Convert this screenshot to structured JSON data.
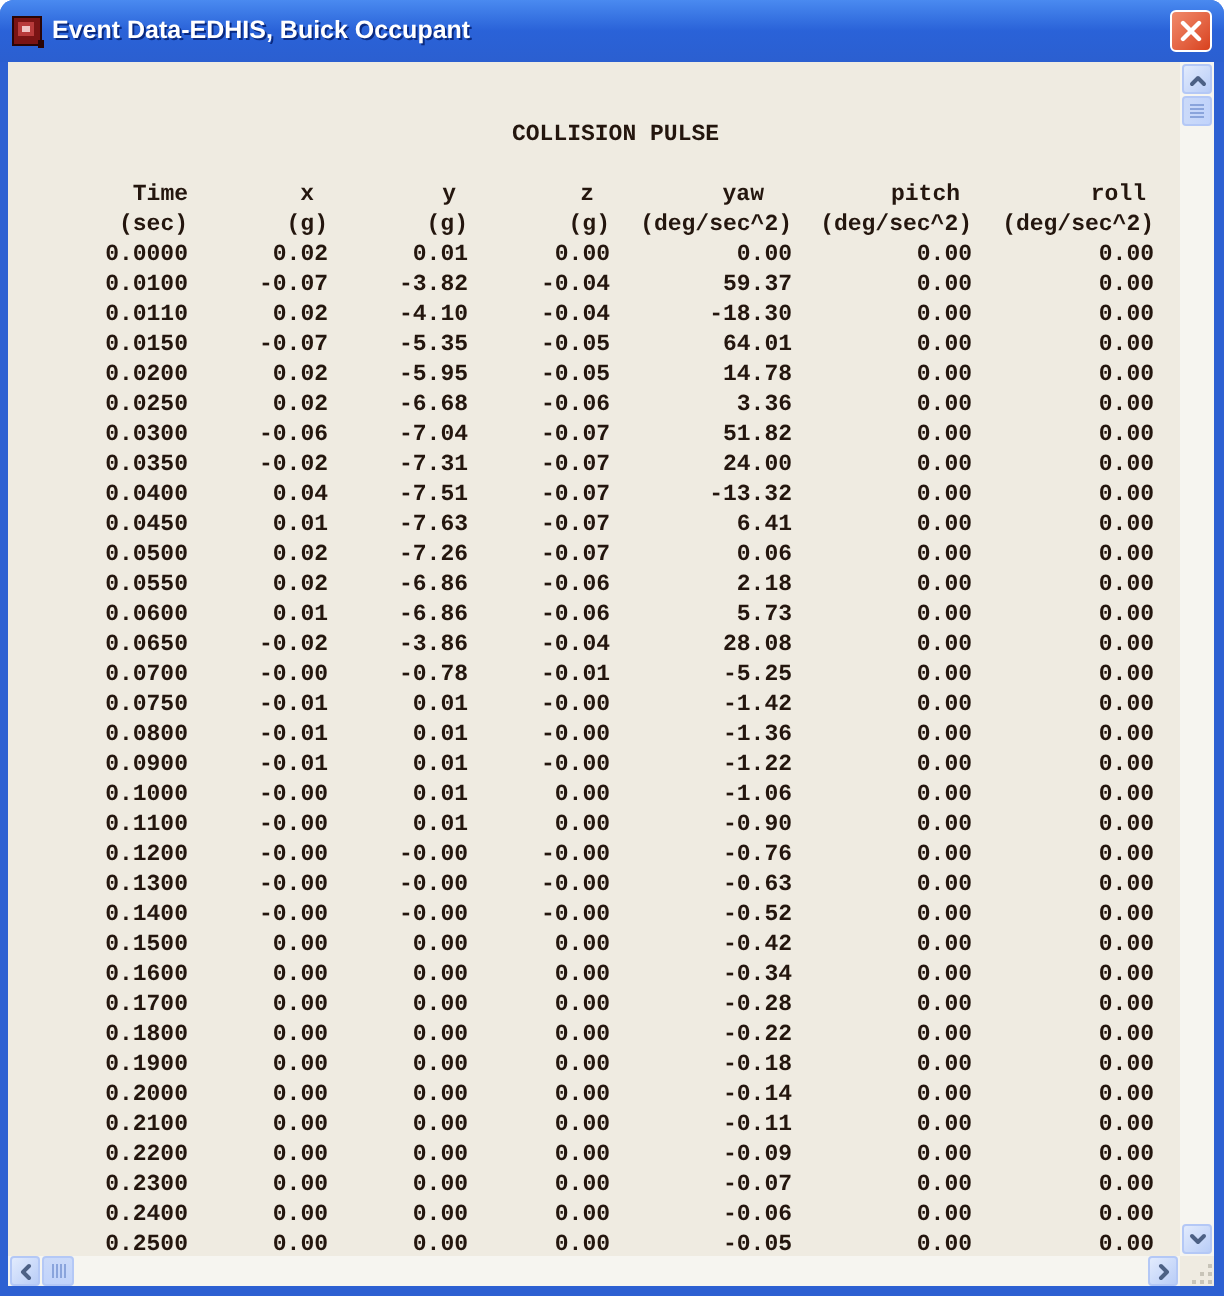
{
  "window": {
    "title": "Event Data-EDHIS, Buick Occupant"
  },
  "report": {
    "title": "COLLISION PULSE",
    "columns": [
      {
        "name": "Time",
        "unit": "(sec)"
      },
      {
        "name": "x",
        "unit": "(g)"
      },
      {
        "name": "y",
        "unit": "(g)"
      },
      {
        "name": "z",
        "unit": "(g)"
      },
      {
        "name": "yaw",
        "unit": "(deg/sec^2)"
      },
      {
        "name": "pitch",
        "unit": "(deg/sec^2)"
      },
      {
        "name": "roll",
        "unit": "(deg/sec^2)"
      }
    ],
    "rows": [
      [
        "0.0000",
        "0.02",
        "0.01",
        "0.00",
        "0.00",
        "0.00",
        "0.00"
      ],
      [
        "0.0100",
        "-0.07",
        "-3.82",
        "-0.04",
        "59.37",
        "0.00",
        "0.00"
      ],
      [
        "0.0110",
        "0.02",
        "-4.10",
        "-0.04",
        "-18.30",
        "0.00",
        "0.00"
      ],
      [
        "0.0150",
        "-0.07",
        "-5.35",
        "-0.05",
        "64.01",
        "0.00",
        "0.00"
      ],
      [
        "0.0200",
        "0.02",
        "-5.95",
        "-0.05",
        "14.78",
        "0.00",
        "0.00"
      ],
      [
        "0.0250",
        "0.02",
        "-6.68",
        "-0.06",
        "3.36",
        "0.00",
        "0.00"
      ],
      [
        "0.0300",
        "-0.06",
        "-7.04",
        "-0.07",
        "51.82",
        "0.00",
        "0.00"
      ],
      [
        "0.0350",
        "-0.02",
        "-7.31",
        "-0.07",
        "24.00",
        "0.00",
        "0.00"
      ],
      [
        "0.0400",
        "0.04",
        "-7.51",
        "-0.07",
        "-13.32",
        "0.00",
        "0.00"
      ],
      [
        "0.0450",
        "0.01",
        "-7.63",
        "-0.07",
        "6.41",
        "0.00",
        "0.00"
      ],
      [
        "0.0500",
        "0.02",
        "-7.26",
        "-0.07",
        "0.06",
        "0.00",
        "0.00"
      ],
      [
        "0.0550",
        "0.02",
        "-6.86",
        "-0.06",
        "2.18",
        "0.00",
        "0.00"
      ],
      [
        "0.0600",
        "0.01",
        "-6.86",
        "-0.06",
        "5.73",
        "0.00",
        "0.00"
      ],
      [
        "0.0650",
        "-0.02",
        "-3.86",
        "-0.04",
        "28.08",
        "0.00",
        "0.00"
      ],
      [
        "0.0700",
        "-0.00",
        "-0.78",
        "-0.01",
        "-5.25",
        "0.00",
        "0.00"
      ],
      [
        "0.0750",
        "-0.01",
        "0.01",
        "-0.00",
        "-1.42",
        "0.00",
        "0.00"
      ],
      [
        "0.0800",
        "-0.01",
        "0.01",
        "-0.00",
        "-1.36",
        "0.00",
        "0.00"
      ],
      [
        "0.0900",
        "-0.01",
        "0.01",
        "-0.00",
        "-1.22",
        "0.00",
        "0.00"
      ],
      [
        "0.1000",
        "-0.00",
        "0.01",
        "0.00",
        "-1.06",
        "0.00",
        "0.00"
      ],
      [
        "0.1100",
        "-0.00",
        "0.01",
        "0.00",
        "-0.90",
        "0.00",
        "0.00"
      ],
      [
        "0.1200",
        "-0.00",
        "-0.00",
        "-0.00",
        "-0.76",
        "0.00",
        "0.00"
      ],
      [
        "0.1300",
        "-0.00",
        "-0.00",
        "-0.00",
        "-0.63",
        "0.00",
        "0.00"
      ],
      [
        "0.1400",
        "-0.00",
        "-0.00",
        "-0.00",
        "-0.52",
        "0.00",
        "0.00"
      ],
      [
        "0.1500",
        "0.00",
        "0.00",
        "0.00",
        "-0.42",
        "0.00",
        "0.00"
      ],
      [
        "0.1600",
        "0.00",
        "0.00",
        "0.00",
        "-0.34",
        "0.00",
        "0.00"
      ],
      [
        "0.1700",
        "0.00",
        "0.00",
        "0.00",
        "-0.28",
        "0.00",
        "0.00"
      ],
      [
        "0.1800",
        "0.00",
        "0.00",
        "0.00",
        "-0.22",
        "0.00",
        "0.00"
      ],
      [
        "0.1900",
        "0.00",
        "0.00",
        "0.00",
        "-0.18",
        "0.00",
        "0.00"
      ],
      [
        "0.2000",
        "0.00",
        "0.00",
        "0.00",
        "-0.14",
        "0.00",
        "0.00"
      ],
      [
        "0.2100",
        "0.00",
        "0.00",
        "0.00",
        "-0.11",
        "0.00",
        "0.00"
      ],
      [
        "0.2200",
        "0.00",
        "0.00",
        "0.00",
        "-0.09",
        "0.00",
        "0.00"
      ],
      [
        "0.2300",
        "0.00",
        "0.00",
        "0.00",
        "-0.07",
        "0.00",
        "0.00"
      ],
      [
        "0.2400",
        "0.00",
        "0.00",
        "0.00",
        "-0.06",
        "0.00",
        "0.00"
      ],
      [
        "0.2500",
        "0.00",
        "0.00",
        "0.00",
        "-0.05",
        "0.00",
        "0.00"
      ]
    ]
  }
}
